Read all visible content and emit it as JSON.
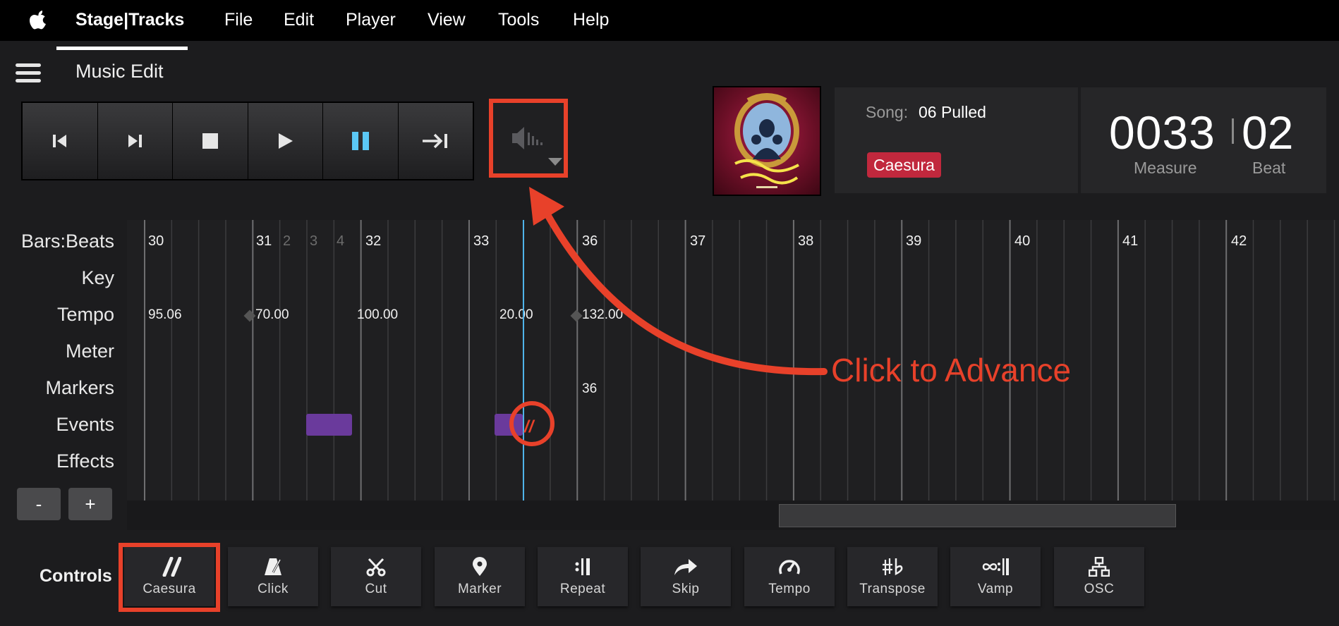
{
  "menubar": {
    "app_name": "Stage|Tracks",
    "items": [
      "File",
      "Edit",
      "Player",
      "View",
      "Tools",
      "Help"
    ]
  },
  "header": {
    "title": "Music Edit"
  },
  "transport": {
    "buttons": [
      "skip-to-start-icon",
      "next-icon",
      "stop-icon",
      "play-icon",
      "pause-icon",
      "skip-to-end-icon"
    ],
    "active_color": "#5bc8f5"
  },
  "song": {
    "label": "Song:",
    "name": "06 Pulled",
    "badge": "Caesura",
    "badge_color": "#c1283d"
  },
  "counter": {
    "measure": "0033",
    "beat": "02",
    "measure_label": "Measure",
    "beat_label": "Beat"
  },
  "lanes": [
    "Bars:Beats",
    "Key",
    "Tempo",
    "Meter",
    "Markers",
    "Events",
    "Effects"
  ],
  "timeline": {
    "bars": [
      "30",
      "31",
      "32",
      "33",
      "36",
      "37",
      "38",
      "39",
      "40",
      "41",
      "42"
    ],
    "sub_beats": [
      "2",
      "3",
      "4"
    ],
    "tempos": [
      "95.06",
      "70.00",
      "100.00",
      "20.00",
      "132.00"
    ],
    "marker": "36",
    "playhead_color": "#4fb3ea",
    "event_color": "#6a3a9c"
  },
  "zoom": {
    "minus": "-",
    "plus": "+"
  },
  "annotation": {
    "text": "Click to Advance",
    "color": "#e8412a"
  },
  "controls": {
    "label": "Controls",
    "items": [
      {
        "label": "Caesura",
        "icon": "caesura-icon"
      },
      {
        "label": "Click",
        "icon": "metronome-icon"
      },
      {
        "label": "Cut",
        "icon": "scissors-icon"
      },
      {
        "label": "Marker",
        "icon": "map-pin-icon"
      },
      {
        "label": "Repeat",
        "icon": "repeat-icon"
      },
      {
        "label": "Skip",
        "icon": "skip-arrow-icon"
      },
      {
        "label": "Tempo",
        "icon": "gauge-icon"
      },
      {
        "label": "Transpose",
        "icon": "sharp-flat-icon"
      },
      {
        "label": "Vamp",
        "icon": "vamp-icon"
      },
      {
        "label": "OSC",
        "icon": "network-icon"
      }
    ]
  }
}
